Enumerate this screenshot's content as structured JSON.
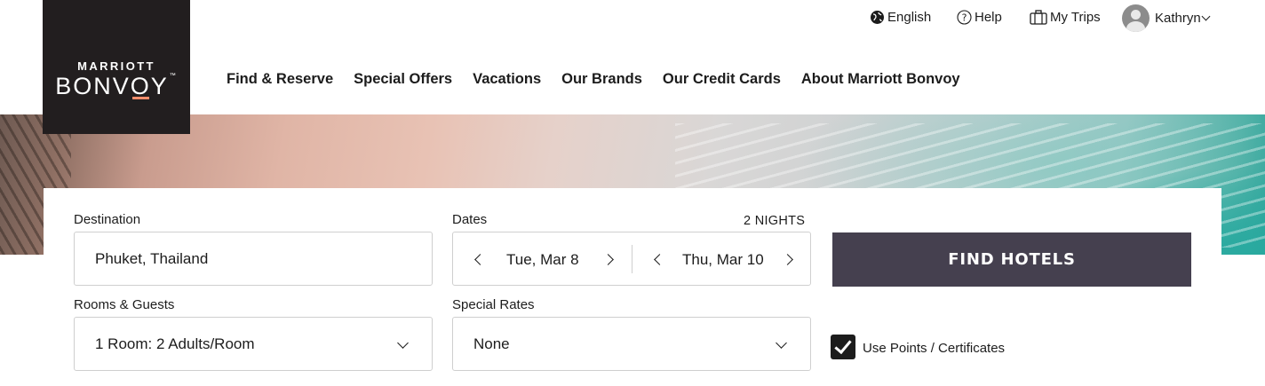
{
  "brand": {
    "line1": "MARRIOTT",
    "line2_pre": "BONV",
    "line2_o": "O",
    "line2_post": "Y",
    "tm": "™"
  },
  "utility": {
    "language": "English",
    "help": "Help",
    "trips": "My Trips",
    "user": "Kathryn"
  },
  "nav": {
    "items": [
      "Find & Reserve",
      "Special Offers",
      "Vacations",
      "Our Brands",
      "Our Credit Cards",
      "About Marriott Bonvoy"
    ]
  },
  "search": {
    "destination_label": "Destination",
    "destination_value": "Phuket, Thailand",
    "dates_label": "Dates",
    "nights": "2 NIGHTS",
    "check_in": "Tue, Mar 8",
    "check_out": "Thu, Mar 10",
    "rooms_label": "Rooms & Guests",
    "rooms_value": "1 Room: 2 Adults/Room",
    "rates_label": "Special Rates",
    "rates_value": "None",
    "find_button": "FIND HOTELS",
    "use_points_label": "Use Points / Certificates",
    "use_points_checked": true
  },
  "colors": {
    "logo_bg": "#221e1f",
    "logo_accent": "#ff8d6b",
    "button_bg": "#45404f"
  },
  "icons": {
    "language": "globe-icon",
    "help": "help-circle-icon",
    "trips": "suitcase-icon",
    "user": "user-avatar-icon"
  }
}
